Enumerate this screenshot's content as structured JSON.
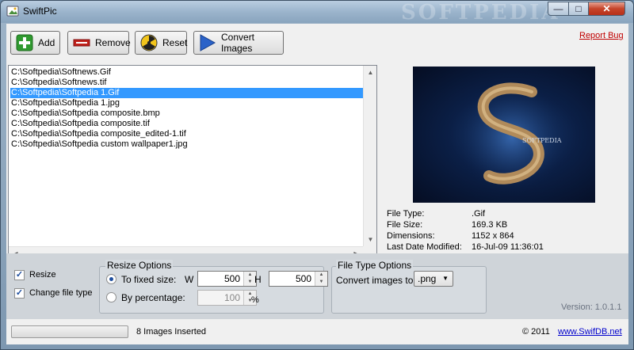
{
  "window": {
    "title": "SwiftPic",
    "watermark": "SOFTPEDIA",
    "minimize_glyph": "—",
    "maximize_glyph": "□",
    "close_glyph": "✕"
  },
  "toolbar": {
    "add_label": "Add",
    "remove_label": "Remove",
    "reset_label": "Reset",
    "convert_label": "Convert Images",
    "report_bug": "Report Bug"
  },
  "file_list": {
    "items": [
      "C:\\Softpedia\\Softnews.Gif",
      "C:\\Softpedia\\Softnews.tif",
      "C:\\Softpedia\\Softpedia 1.Gif",
      "C:\\Softpedia\\Softpedia 1.jpg",
      "C:\\Softpedia\\Softpedia composite.bmp",
      "C:\\Softpedia\\Softpedia composite.tif",
      "C:\\Softpedia\\Softpedia composite_edited-1.tif",
      "C:\\Softpedia\\Softpedia custom wallpaper1.jpg"
    ],
    "selected_index": 2
  },
  "preview": {
    "caption": "SOFTPEDIA"
  },
  "file_info": {
    "type_label": "File Type:",
    "type_value": ".Gif",
    "size_label": "File Size:",
    "size_value": "169.3 KB",
    "dims_label": "Dimensions:",
    "dims_value": "1152 x 864",
    "modified_label": "Last Date Modified:",
    "modified_value": "16-Jul-09 11:36:01"
  },
  "options": {
    "resize_label": "Resize",
    "resize_checked": true,
    "change_type_label": "Change file type",
    "change_type_checked": true,
    "resize_group_title": "Resize Options",
    "fixed_size_label": "To fixed size:",
    "w_label": "W",
    "w_value": "500",
    "h_label": "H",
    "h_value": "500",
    "percentage_label": "By percentage:",
    "percentage_value": "100",
    "percent_sign": "%",
    "filetype_group_title": "File Type Options",
    "convert_to_label": "Convert images to:",
    "convert_to_value": ".png",
    "version": "Version: 1.0.1.1"
  },
  "status": {
    "progress": 0,
    "images_inserted": "8 Images Inserted",
    "copyright": "© 2011",
    "website": "www.SwifDB.net"
  },
  "colors": {
    "selection": "#3399ff",
    "report_bug": "#c00000",
    "link": "#0000cc"
  }
}
